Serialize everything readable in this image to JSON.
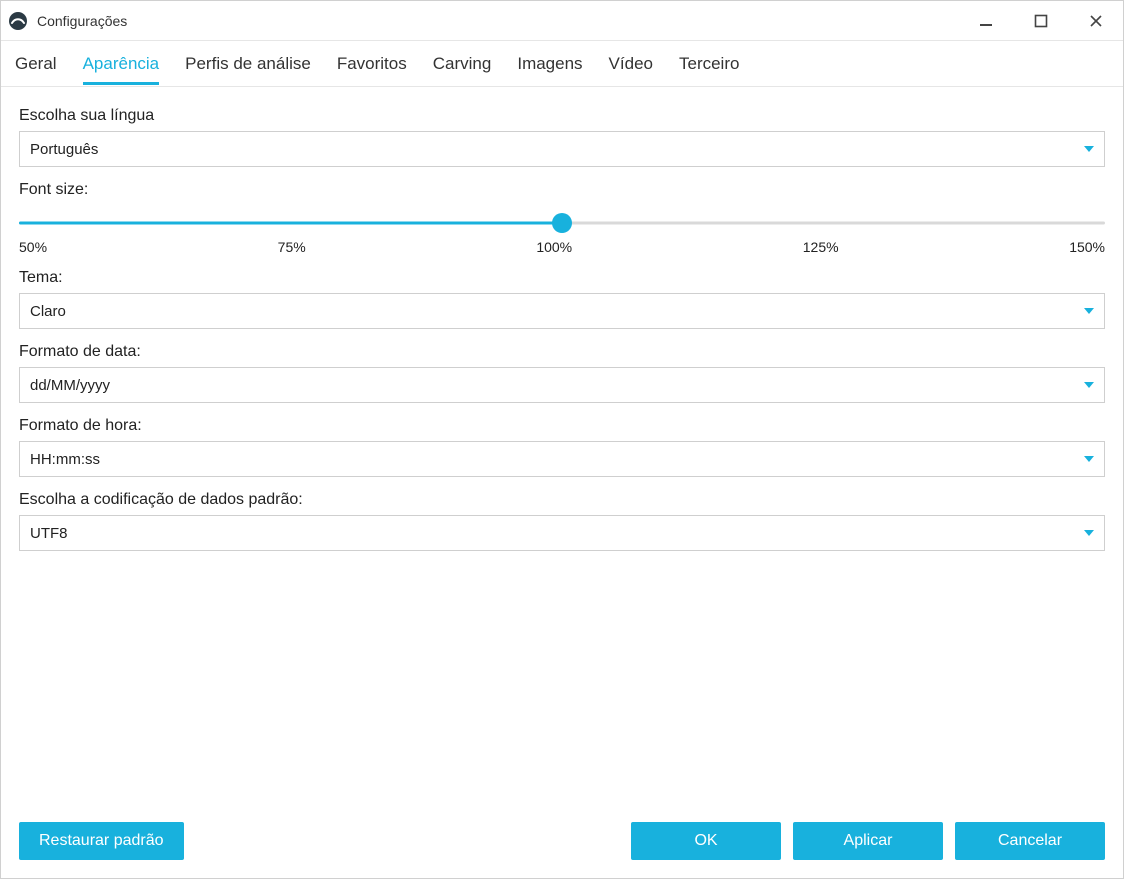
{
  "window": {
    "title": "Configurações"
  },
  "tabs": {
    "items": [
      "Geral",
      "Aparência",
      "Perfis de análise",
      "Favoritos",
      "Carving",
      "Imagens",
      "Vídeo",
      "Terceiro"
    ],
    "active_index": 1
  },
  "form": {
    "language": {
      "label": "Escolha sua língua",
      "value": "Português"
    },
    "font_size": {
      "label": "Font size:",
      "value_percent": 100,
      "ticks": [
        "50%",
        "75%",
        "100%",
        "125%",
        "150%"
      ]
    },
    "theme": {
      "label": "Tema:",
      "value": "Claro"
    },
    "date_format": {
      "label": "Formato de data:",
      "value": "dd/MM/yyyy"
    },
    "time_format": {
      "label": "Formato de hora:",
      "value": "HH:mm:ss"
    },
    "encoding": {
      "label": "Escolha a codificação de dados padrão:",
      "value": "UTF8"
    }
  },
  "footer": {
    "restore": "Restaurar padrão",
    "ok": "OK",
    "apply": "Aplicar",
    "cancel": "Cancelar"
  },
  "colors": {
    "accent": "#18b1dd"
  }
}
